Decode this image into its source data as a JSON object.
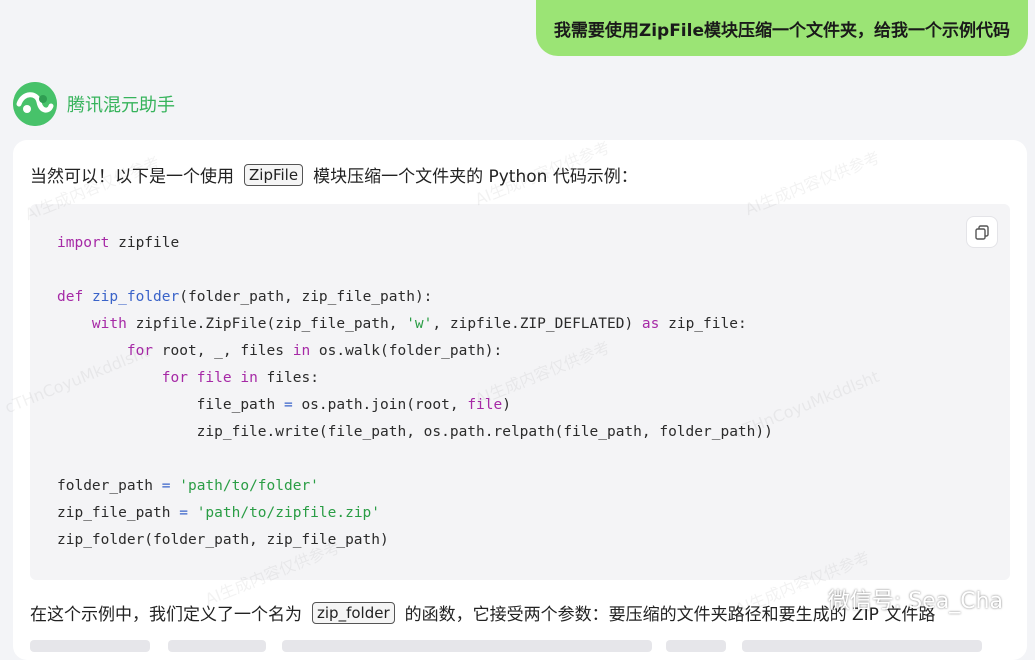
{
  "user_message": "我需要使用ZipFile模块压缩一个文件夹，给我一个示例代码",
  "assistant": {
    "name": "腾讯混元助手",
    "intro_before": "当然可以！以下是一个使用",
    "intro_code": "ZipFile",
    "intro_after": "模块压缩一个文件夹的 Python 代码示例："
  },
  "code_lines": [
    [
      {
        "t": "import",
        "c": "kw"
      },
      {
        "t": " zipfile",
        "c": ""
      }
    ],
    [],
    [
      {
        "t": "def",
        "c": "kw"
      },
      {
        "t": " ",
        "c": ""
      },
      {
        "t": "zip_folder",
        "c": "fn"
      },
      {
        "t": "(folder_path, zip_file_path):",
        "c": ""
      }
    ],
    [
      {
        "t": "    ",
        "c": ""
      },
      {
        "t": "with",
        "c": "kw"
      },
      {
        "t": " zipfile.ZipFile(zip_file_path, ",
        "c": ""
      },
      {
        "t": "'w'",
        "c": "str"
      },
      {
        "t": ", zipfile.ZIP_DEFLATED) ",
        "c": ""
      },
      {
        "t": "as",
        "c": "kw"
      },
      {
        "t": " zip_file:",
        "c": ""
      }
    ],
    [
      {
        "t": "        ",
        "c": ""
      },
      {
        "t": "for",
        "c": "kw"
      },
      {
        "t": " root, _, files ",
        "c": ""
      },
      {
        "t": "in",
        "c": "kw"
      },
      {
        "t": " os.walk(folder_path):",
        "c": ""
      }
    ],
    [
      {
        "t": "            ",
        "c": ""
      },
      {
        "t": "for",
        "c": "kw"
      },
      {
        "t": " ",
        "c": ""
      },
      {
        "t": "file",
        "c": "kw"
      },
      {
        "t": " ",
        "c": ""
      },
      {
        "t": "in",
        "c": "kw"
      },
      {
        "t": " files:",
        "c": ""
      }
    ],
    [
      {
        "t": "                file_path ",
        "c": ""
      },
      {
        "t": "=",
        "c": "op"
      },
      {
        "t": " os.path.join(root, ",
        "c": ""
      },
      {
        "t": "file",
        "c": "kw"
      },
      {
        "t": ")",
        "c": ""
      }
    ],
    [
      {
        "t": "                zip_file.write(file_path, os.path.relpath(file_path, folder_path))",
        "c": ""
      }
    ],
    [],
    [
      {
        "t": "folder_path ",
        "c": ""
      },
      {
        "t": "=",
        "c": "op"
      },
      {
        "t": " ",
        "c": ""
      },
      {
        "t": "'path/to/folder'",
        "c": "str"
      }
    ],
    [
      {
        "t": "zip_file_path ",
        "c": ""
      },
      {
        "t": "=",
        "c": "op"
      },
      {
        "t": " ",
        "c": ""
      },
      {
        "t": "'path/to/zipfile.zip'",
        "c": "str"
      }
    ],
    [
      {
        "t": "zip_folder(folder_path, zip_file_path)",
        "c": ""
      }
    ]
  ],
  "explanation": {
    "before": "在这个示例中，我们定义了一个名为",
    "code": "zip_folder",
    "after": "的函数，它接受两个参数：要压缩的文件夹路径和要生成的 ZIP 文件路"
  },
  "overlay_text": {
    "wechat_label": "微信号: Sea_Cha",
    "watermark_1": "AI生成内容仅供参考",
    "watermark_2": "cTHnCoyuMkddlsht"
  },
  "colors": {
    "user_bubble": "#9be475",
    "assistant_name": "#36b35b",
    "keyword": "#a629a6",
    "function": "#3a63c9",
    "string": "#2a9d45"
  },
  "icons": {
    "logo": "hunyuan-logo-icon",
    "copy": "copy-icon",
    "wechat": "wechat-icon"
  }
}
